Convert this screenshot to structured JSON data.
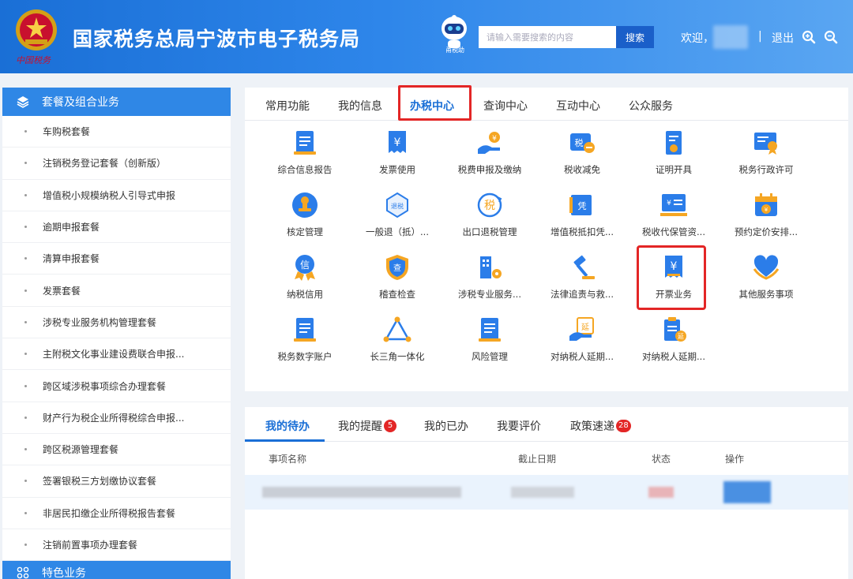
{
  "header": {
    "site_title": "国家税务总局宁波市电子税务局",
    "emblem_sub": "中国税务",
    "robot_label": "甬税助",
    "search_placeholder": "请输入需要搜索的内容",
    "search_button": "搜索",
    "welcome": "欢迎，",
    "separator": "|",
    "logout": "退出",
    "zoom_in_icon": "zoom-in-icon",
    "zoom_out_icon": "zoom-out-icon"
  },
  "sidebar": {
    "header": "套餐及组合业务",
    "items": [
      "车购税套餐",
      "注销税务登记套餐（创新版）",
      "增值税小规模纳税人引导式申报",
      "逾期申报套餐",
      "清算申报套餐",
      "发票套餐",
      "涉税专业服务机构管理套餐",
      "主附税文化事业建设费联合申报...",
      "跨区域涉税事项综合办理套餐",
      "财产行为税企业所得税综合申报...",
      "跨区税源管理套餐",
      "签署银税三方划缴协议套餐",
      "非居民扣缴企业所得税报告套餐",
      "注销前置事项办理套餐"
    ],
    "footer": "特色业务"
  },
  "main_tabs": [
    "常用功能",
    "我的信息",
    "办税中心",
    "查询中心",
    "互动中心",
    "公众服务"
  ],
  "active_tab": "办税中心",
  "services": [
    [
      "综合信息报告",
      "发票使用",
      "税费申报及缴纳",
      "税收减免",
      "证明开具",
      "税务行政许可"
    ],
    [
      "核定管理",
      "一般退（抵）...",
      "出口退税管理",
      "增值税抵扣凭...",
      "税收代保管资...",
      "预约定价安排..."
    ],
    [
      "纳税信用",
      "稽查检查",
      "涉税专业服务...",
      "法律追责与救...",
      "开票业务",
      "其他服务事项"
    ],
    [
      "税务数字账户",
      "长三角一体化",
      "风险管理",
      "对纳税人延期...",
      "对纳税人延期..."
    ]
  ],
  "icon_glyphs": {
    "tax": "税",
    "refund": "退税",
    "voucher": "凭",
    "credit": "信",
    "audit": "查",
    "extend": "延",
    "yuan": "¥"
  },
  "todo": {
    "tabs": [
      {
        "label": "我的待办",
        "badge": ""
      },
      {
        "label": "我的提醒",
        "badge": "5"
      },
      {
        "label": "我的已办",
        "badge": ""
      },
      {
        "label": "我要评价",
        "badge": ""
      },
      {
        "label": "政策速递",
        "badge": "28"
      }
    ],
    "columns": [
      "事项名称",
      "截止日期",
      "状态",
      "操作"
    ]
  },
  "colors": {
    "primary": "#1a6fd6",
    "sidebar_head": "#2f87e6",
    "highlight": "#e32626",
    "icon_blue": "#2b7de9",
    "icon_orange": "#f5a623"
  }
}
